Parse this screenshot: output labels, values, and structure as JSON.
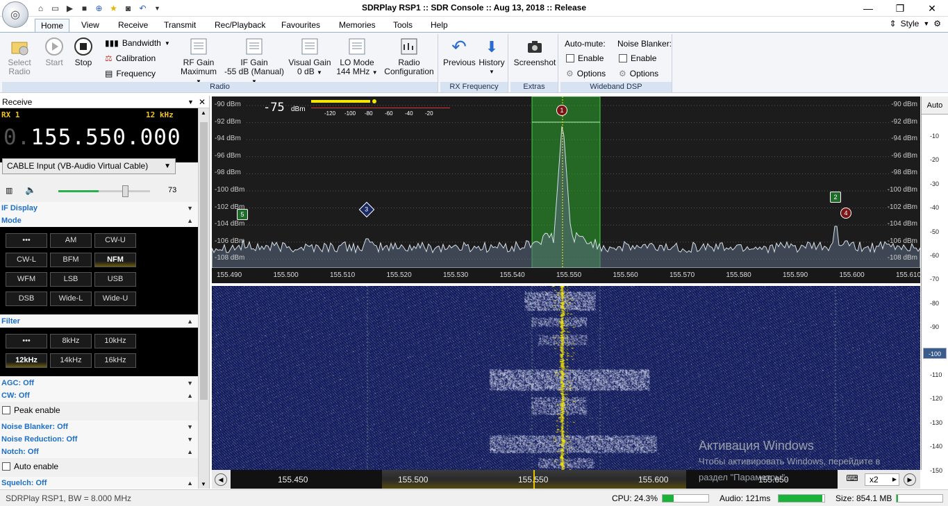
{
  "titlebar": {
    "title": "SDRPlay RSP1 :: SDR Console :: Aug 13, 2018 :: Release",
    "minimize": "—",
    "restore": "❐",
    "close": "✕"
  },
  "menu_tabs": [
    "Home",
    "View",
    "Receive",
    "Transmit",
    "Rec/Playback",
    "Favourites",
    "Memories",
    "Tools",
    "Help"
  ],
  "style_label": "Style",
  "ribbon": {
    "select_radio": [
      "Select",
      "Radio"
    ],
    "start": "Start",
    "stop": "Stop",
    "bandwidth": "Bandwidth",
    "calibration": "Calibration",
    "frequency": "Frequency",
    "rf_gain": [
      "RF Gain",
      "Maximum"
    ],
    "if_gain": [
      "IF Gain",
      "-55 dB (Manual)"
    ],
    "visual_gain": [
      "Visual Gain",
      "0 dB"
    ],
    "lo_mode": [
      "LO Mode",
      "144 MHz"
    ],
    "radio_config": [
      "Radio",
      "Configuration"
    ],
    "group_radio": "Radio",
    "previous": "Previous",
    "history": "History",
    "group_rxfreq": "RX Frequency",
    "screenshot": "Screenshot",
    "group_extras": "Extras",
    "automute": "Auto-mute:",
    "automute_enable": "Enable",
    "automute_options": "Options",
    "nb": "Noise Blanker:",
    "nb_enable": "Enable",
    "nb_options": "Options",
    "group_wbdsp": "Wideband DSP"
  },
  "receive_panel": {
    "header": "Receive",
    "rx": "RX 1",
    "bw": "12 kHz",
    "freq_dim": "0.",
    "freq": "155.550.000",
    "audio_device": "CABLE Input (VB-Audio Virtual Cable)",
    "volume": "73",
    "volume_level": 0.73,
    "if_display": "IF Display",
    "mode": "Mode",
    "modes": [
      "•••",
      "AM",
      "CW-U",
      "CW-L",
      "BFM",
      "NFM",
      "WFM",
      "LSB",
      "USB",
      "DSB",
      "Wide-L",
      "Wide-U"
    ],
    "mode_selected": "NFM",
    "filter": "Filter",
    "filters": [
      "•••",
      "8kHz",
      "10kHz",
      "12kHz",
      "14kHz",
      "16kHz"
    ],
    "filter_selected": "12kHz",
    "agc": "AGC: Off",
    "cw": "CW: Off",
    "peak_enable": "Peak enable",
    "noise_blanker": "Noise Blanker: Off",
    "noise_reduction": "Noise Reduction: Off",
    "notch": "Notch: Off",
    "auto_enable": "Auto enable",
    "squelch": "Squelch: Off"
  },
  "spectrum": {
    "signal_level": "-75",
    "signal_unit": "dBm",
    "smeter_ticks": [
      "-120",
      "-100",
      "-80",
      "-60",
      "-40",
      "-20"
    ],
    "dbm_labels": [
      "-90 dBm",
      "-92 dBm",
      "-94 dBm",
      "-96 dBm",
      "-98 dBm",
      "-100 dBm",
      "-102 dBm",
      "-104 dBm",
      "-106 dBm",
      "-108 dBm"
    ],
    "markers": [
      "1",
      "2",
      "3",
      "4",
      "5"
    ],
    "freq_ticks": [
      "155.490",
      "155.500",
      "155.510",
      "155.520",
      "155.530",
      "155.540",
      "155.550",
      "155.560",
      "155.570",
      "155.580",
      "155.590",
      "155.600",
      "155.610"
    ],
    "colors": {
      "passband": "#2ea82e",
      "spectrum": "#cfd8e0",
      "waterfall_bg": "#0a1450",
      "signal": "#ffee00"
    }
  },
  "right_scale": {
    "auto": "Auto",
    "ticks": [
      "-10",
      "-20",
      "-30",
      "-40",
      "-50",
      "-60",
      "-70",
      "-80",
      "-90",
      "-100",
      "-110",
      "-120",
      "-130",
      "-140",
      "-150"
    ],
    "selected": "-100"
  },
  "bottom_nav": {
    "ticks": [
      "155.450",
      "155.500",
      "155.550",
      "155.600",
      "155.650"
    ],
    "zoom": "x2"
  },
  "watermark": {
    "line1": "Активация Windows",
    "line2": "Чтобы активировать Windows, перейдите в",
    "line3": "раздел \"Параметры\"."
  },
  "status": {
    "device": "SDRPlay RSP1, BW = 8.000 MHz",
    "cpu": "CPU: 24.3%",
    "cpu_level": 0.243,
    "audio": "Audio: 121ms",
    "audio_level": 0.95,
    "size": "Size: 854.1 MB"
  }
}
